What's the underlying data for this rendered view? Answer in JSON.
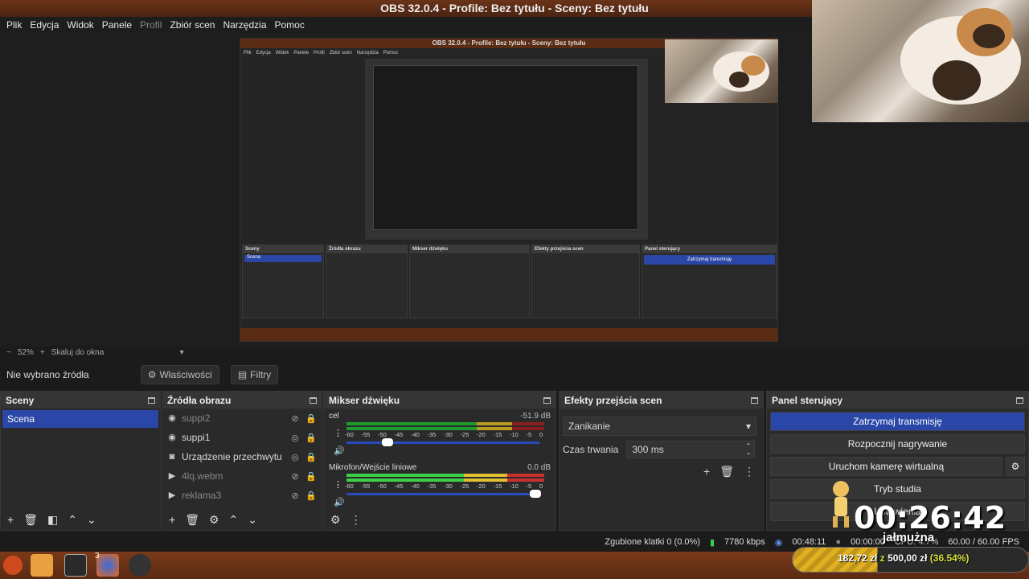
{
  "window": {
    "title": "OBS 32.0.4 - Profile: Bez tytułu - Sceny: Bez tytułu"
  },
  "menu": [
    "Plik",
    "Edycja",
    "Widok",
    "Panele",
    "Profil",
    "Zbiór scen",
    "Narzędzia",
    "Pomoc"
  ],
  "zoom": {
    "minus": "−",
    "value": "52%",
    "plus": "+",
    "mode": "Skaluj do okna"
  },
  "source_bar": {
    "no_source": "Nie wybrano źródła",
    "properties": "Właściwości",
    "filters": "Filtry"
  },
  "scenes": {
    "title": "Sceny",
    "items": [
      {
        "name": "Scena",
        "selected": true
      }
    ]
  },
  "sources": {
    "title": "Źródła obrazu",
    "items": [
      {
        "name": "suppi2",
        "icon": "browser-icon",
        "visible": false
      },
      {
        "name": "suppi1",
        "icon": "browser-icon",
        "visible": true
      },
      {
        "name": "Urządzenie przechwytu",
        "icon": "camera-icon",
        "visible": true
      },
      {
        "name": "4lq.webm",
        "icon": "play-icon",
        "visible": false
      },
      {
        "name": "reklama3",
        "icon": "play-icon",
        "visible": false
      }
    ]
  },
  "mixer": {
    "title": "Mikser dźwięku",
    "channels": [
      {
        "name": "cel",
        "db": "-51.9 dB",
        "volume": 0.22
      },
      {
        "name": "Mikrofon/Wejście liniowe",
        "db": "0.0 dB",
        "volume": 1.0
      }
    ],
    "scale": [
      "-60",
      "-55",
      "-50",
      "-45",
      "-40",
      "-35",
      "-30",
      "-25",
      "-20",
      "-15",
      "-10",
      "-5",
      "0"
    ]
  },
  "transitions": {
    "title": "Efekty przejścia scen",
    "selected": "Zanikanie",
    "duration_label": "Czas trwania",
    "duration": "300 ms"
  },
  "controls": {
    "title": "Panel sterujący",
    "buttons": [
      "Zatrzymaj transmisję",
      "Rozpocznij nagrywanie",
      "Uruchom kamerę wirtualną",
      "Tryb studia",
      "Ustawienia"
    ]
  },
  "status": {
    "dropped": "Zgubione klatki 0 (0.0%)",
    "bitrate": "7780 kbps",
    "stream_time": "00:48:11",
    "rec_time": "00:00:00",
    "cpu": "CPU: 4.7%",
    "fps": "60.00 / 60.00 FPS"
  },
  "overlay": {
    "timer": "00:26:42",
    "label": "jałmużna",
    "donation": "182,72 zł",
    "of": "z",
    "goal": "500,00 zł",
    "percent": "(36.54%)"
  },
  "taskbar": {
    "badge": "3"
  },
  "colors": {
    "accent": "#2a46a6",
    "titlebar": "#5a2c14",
    "meter_green": "#1f9a2e",
    "meter_yellow": "#b89a1e",
    "meter_red": "#8a1e1e"
  }
}
